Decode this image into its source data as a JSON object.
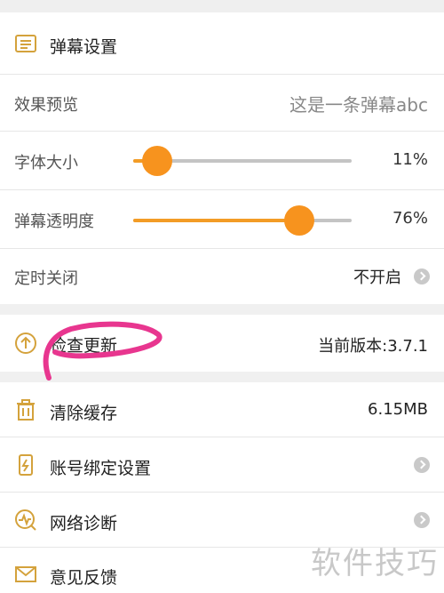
{
  "danmaku": {
    "title": "弹幕设置",
    "preview_label": "效果预览",
    "preview_text": "这是一条弹幕abc",
    "font_size_label": "字体大小",
    "font_size_percent": 11,
    "font_size_text": "11%",
    "opacity_label": "弹幕透明度",
    "opacity_percent": 76,
    "opacity_text": "76%",
    "timer_label": "定时关闭",
    "timer_value": "不开启"
  },
  "update": {
    "label": "检查更新",
    "version": "当前版本:3.7.1"
  },
  "cache": {
    "label": "清除缓存",
    "size": "6.15MB"
  },
  "account": {
    "label": "账号绑定设置"
  },
  "network": {
    "label": "网络诊断"
  },
  "feedback": {
    "label": "意见反馈"
  },
  "watermark": "软件技巧",
  "colors": {
    "accent": "#f7931e",
    "icon": "#d4a23c",
    "annotation": "#e8368f"
  },
  "icons": {
    "danmaku": "list-doc-icon",
    "update": "arrow-up-circle-icon",
    "cache": "trash-icon",
    "account": "phone-lightning-icon",
    "network": "pulse-circle-icon",
    "feedback": "mail-icon",
    "chevron": "chevron-right-icon"
  }
}
